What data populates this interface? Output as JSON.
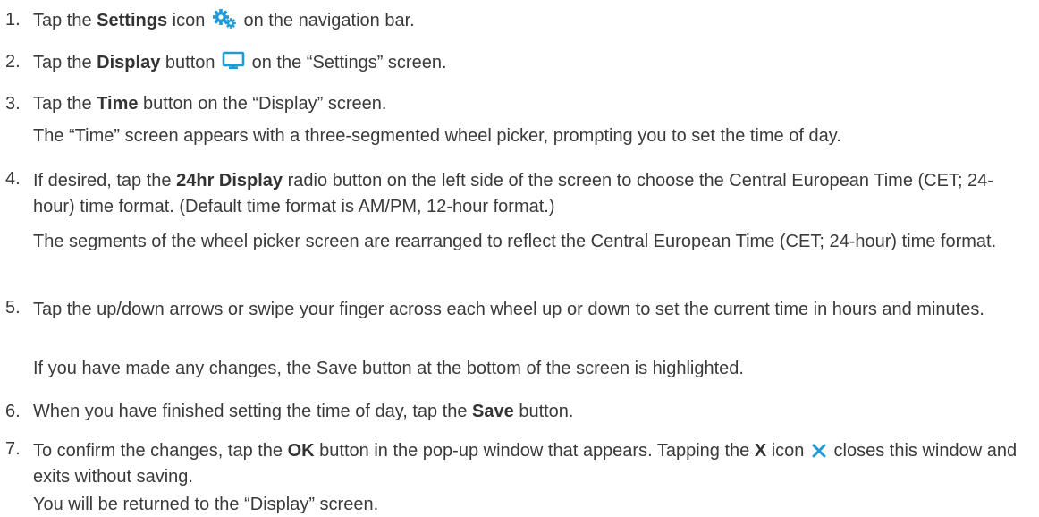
{
  "steps": [
    {
      "num": "1.",
      "pre": "Tap the ",
      "bold": "Settings",
      "mid": " icon",
      "post": " on the navigation bar."
    },
    {
      "num": "2.",
      "pre": "Tap the ",
      "bold": "Display",
      "mid": " button",
      "post": " on the “Settings” screen."
    },
    {
      "num": "3.",
      "pre": "Tap the ",
      "bold": "Time",
      "post": " button on the “Display” screen.",
      "note": "The “Time” screen appears with a three-segmented wheel picker, prompting you to set the time of day."
    },
    {
      "num": "4.",
      "pre": "If desired, tap the ",
      "bold": "24hr Display",
      "post": " radio button on the left side of the screen to choose the Central European Time (CET; 24-hour) time format. (Default time format is AM/PM, 12-hour format.)",
      "note": "The segments of the wheel picker screen are rearranged to reflect the Central European Time (CET; 24-hour) time format."
    },
    {
      "num": "5.",
      "text": "Tap the up/down arrows or swipe your finger across each wheel up or down to set the current time in hours and minutes.",
      "note": "If you have made any changes, the Save button at the bottom of the screen is highlighted."
    },
    {
      "num": "6.",
      "pre": "When you have finished setting the time of day, tap the ",
      "bold": "Save",
      "post": " button."
    },
    {
      "num": "7.",
      "pre": "To confirm the changes, tap the ",
      "bold": "OK",
      "mid": " button in the pop-up window that appears. Tapping the ",
      "bold2": "X",
      "mid2": " icon",
      "post": " closes this window and exits without saving.",
      "note": "You will be returned to the “Display” screen."
    }
  ],
  "colors": {
    "text": "#3a3a3a",
    "icon_accent": "#1e9ad6"
  },
  "icons": {
    "settings": "gear-icon",
    "display": "monitor-icon",
    "close": "close-x-icon"
  }
}
